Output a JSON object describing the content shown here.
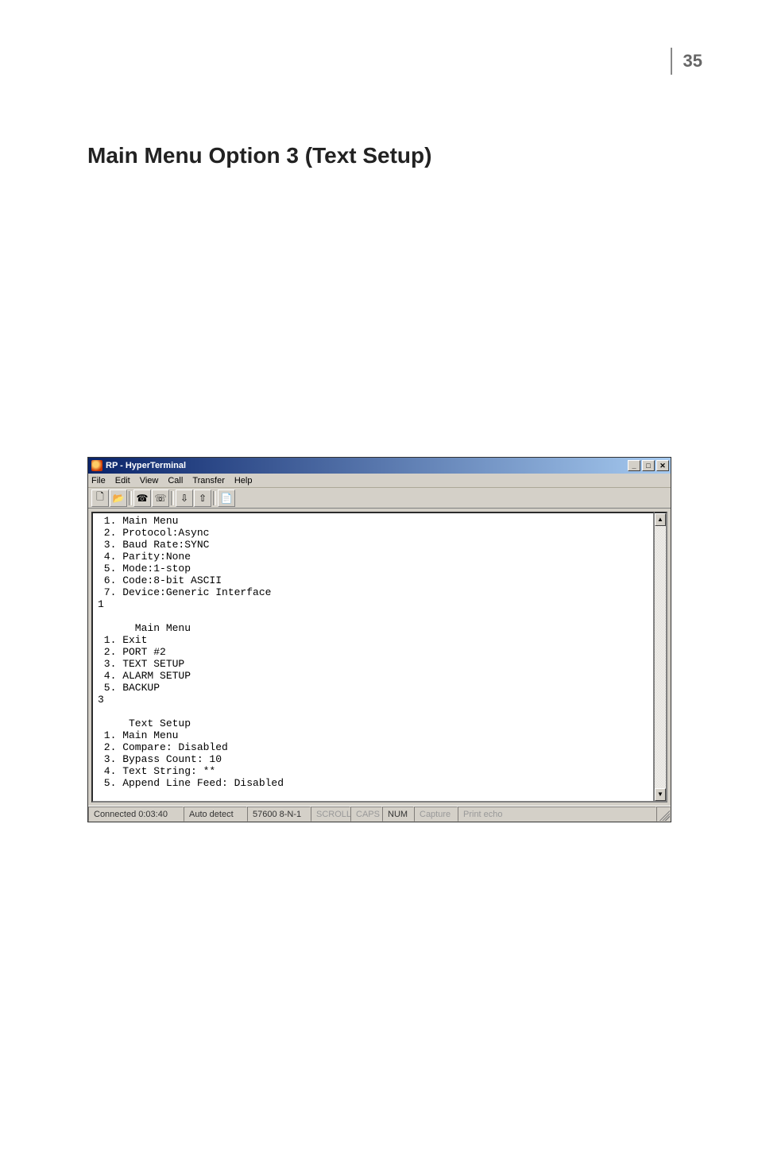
{
  "page_number": "35",
  "heading": "Main Menu Option 3 (Text Setup)",
  "window": {
    "title": "RP - HyperTerminal",
    "menu": [
      "File",
      "Edit",
      "View",
      "Call",
      "Transfer",
      "Help"
    ],
    "window_controls": {
      "min": "_",
      "max": "□",
      "close": "✕"
    },
    "toolbar_icons": [
      "new-doc-icon",
      "open-icon",
      "sep",
      "phone-icon",
      "hangup-icon",
      "sep",
      "send-icon",
      "receive-icon",
      "sep",
      "properties-icon"
    ],
    "terminal_text": " 1. Main Menu\n 2. Protocol:Async\n 3. Baud Rate:SYNC\n 4. Parity:None\n 5. Mode:1-stop\n 6. Code:8-bit ASCII\n 7. Device:Generic Interface\n1\n\n      Main Menu\n 1. Exit\n 2. PORT #2\n 3. TEXT SETUP\n 4. ALARM SETUP\n 5. BACKUP\n3\n\n     Text Setup\n 1. Main Menu\n 2. Compare: Disabled\n 3. Bypass Count: 10\n 4. Text String: **\n 5. Append Line Feed: Disabled\n\n_",
    "status": {
      "connected": "Connected 0:03:40",
      "detect": "Auto detect",
      "port": "57600 8-N-1",
      "scroll": "SCROLL",
      "caps": "CAPS",
      "num": "NUM",
      "capture": "Capture",
      "echo": "Print echo"
    }
  }
}
